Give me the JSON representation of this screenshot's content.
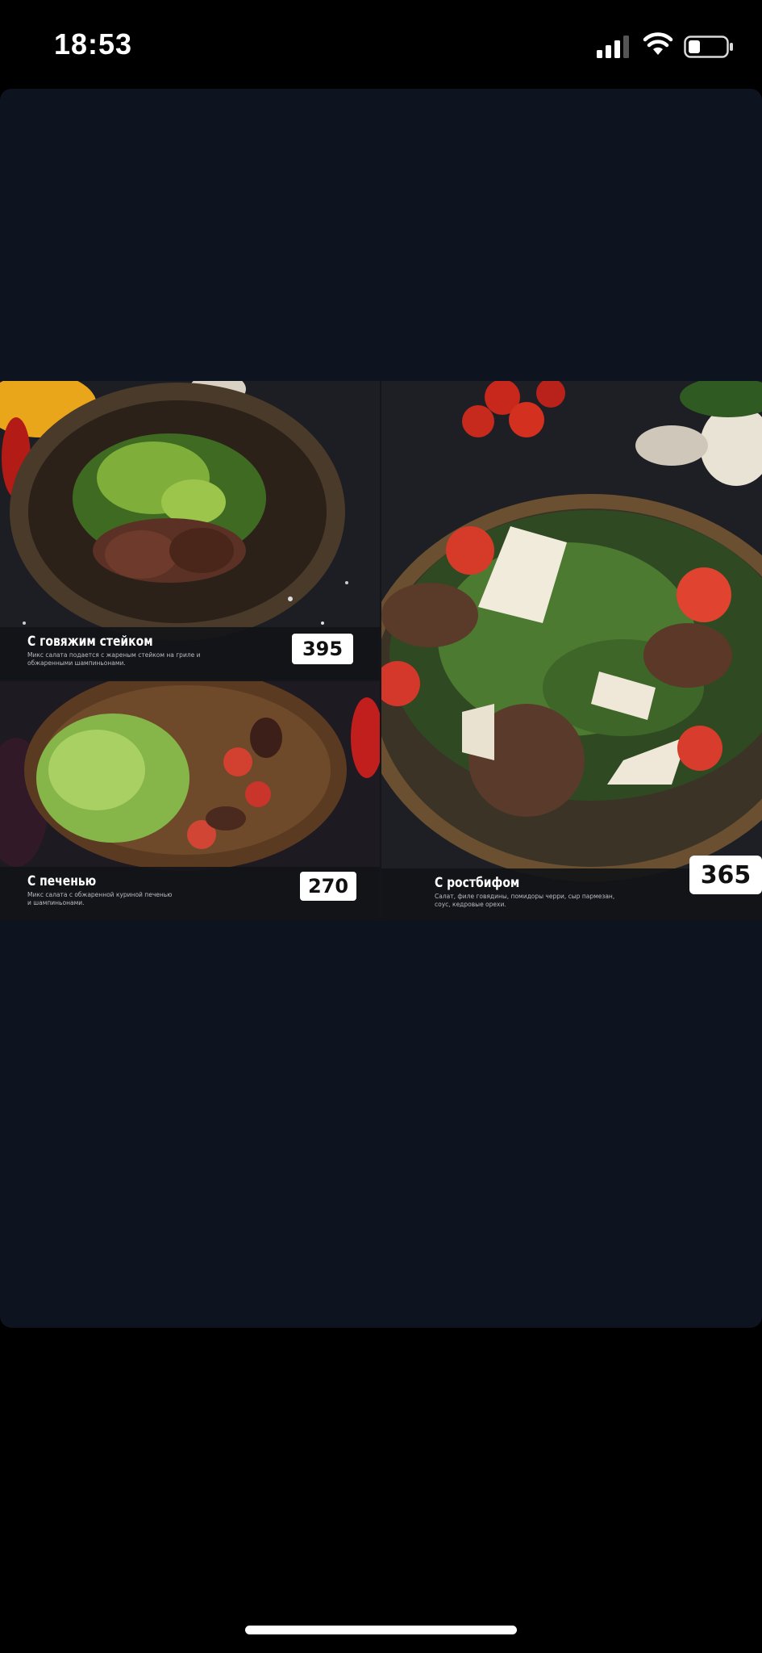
{
  "status_bar": {
    "time": "18:53",
    "signal_icon": "cellular-signal-icon",
    "wifi_icon": "wifi-icon",
    "battery_icon": "battery-icon"
  },
  "menu": {
    "items": [
      {
        "title": "С говяжим стейком",
        "description": "Микс салата подается с жареным стейком на гриле и\nобжаренными шампиньонами.",
        "price": "395"
      },
      {
        "title": "С печенью",
        "description": "Микс салата с обжаренной куриной печенью\nи шампиньонами.",
        "price": "270"
      },
      {
        "title": "С ростбифом",
        "description": "Салат, филе говядины, помидоры черри, сыр пармезан,\nсоус, кедровые орехи.",
        "price": "365"
      }
    ]
  },
  "colors": {
    "viewer_bg": "#0e1320",
    "price_tag_bg": "#ffffff"
  }
}
